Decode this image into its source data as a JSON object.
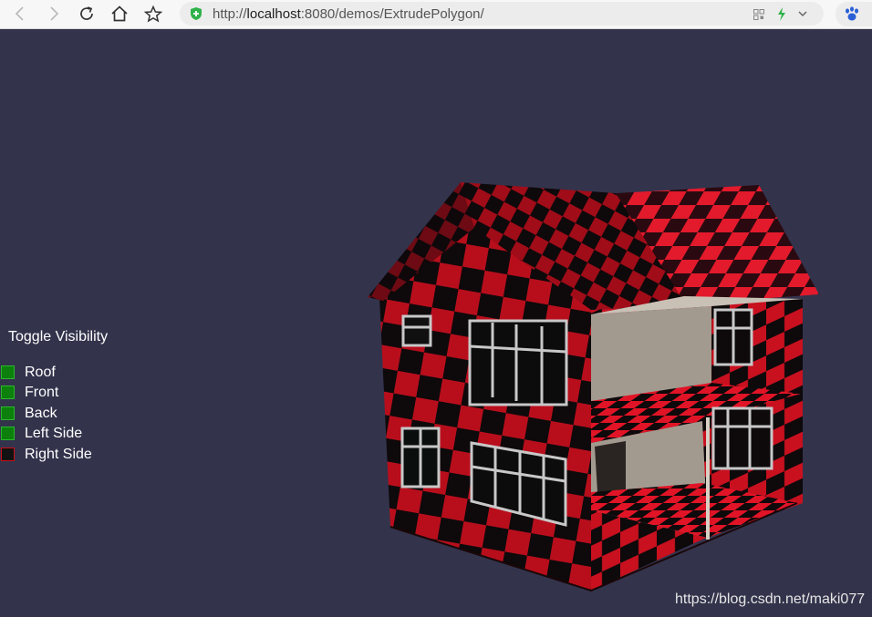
{
  "browser": {
    "url_prefix": "http://",
    "url_host": "localhost",
    "url_rest": ":8080/demos/ExtrudePolygon/"
  },
  "panel": {
    "title": "Toggle Visibility",
    "items": [
      {
        "label": "Roof",
        "checked": true
      },
      {
        "label": "Front",
        "checked": true
      },
      {
        "label": "Back",
        "checked": true
      },
      {
        "label": "Left Side",
        "checked": true
      },
      {
        "label": "Right Side",
        "checked": false
      }
    ]
  },
  "watermark": "https://blog.csdn.net/maki077",
  "colors": {
    "background": "#33334c",
    "checker_red": "#c01020",
    "checker_black": "#100a0c",
    "wall_beige": "#a39a8f",
    "window_frame": "#c8c8c8",
    "checkbox_on": "#0c7f0c",
    "checkbox_off": "#121212"
  },
  "icons": [
    "back-arrow-icon",
    "forward-arrow-icon",
    "reload-icon",
    "home-icon",
    "star-icon",
    "shield-icon",
    "qr-icon",
    "lightning-icon",
    "chevron-down-icon",
    "paw-icon"
  ]
}
